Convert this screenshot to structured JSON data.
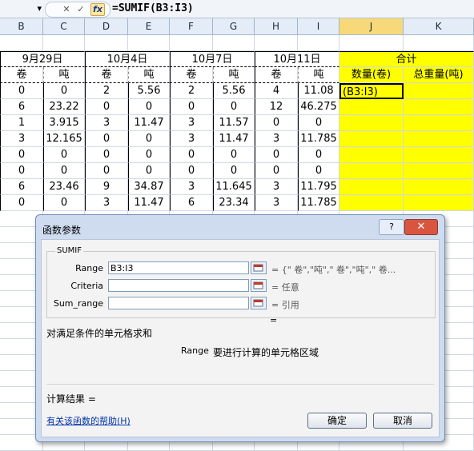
{
  "formula_bar": {
    "name_box_arrow": "▾",
    "cancel_icon": "✕",
    "enter_icon": "✓",
    "fx_label": "fx",
    "formula": "=SUMIF(B3:I3)"
  },
  "columns": [
    "B",
    "C",
    "D",
    "E",
    "F",
    "G",
    "H",
    "I",
    "J",
    "K"
  ],
  "header": {
    "dates": [
      "9月29日",
      "10月4日",
      "10月7日",
      "10月11日"
    ],
    "total": "合计",
    "unit_juan": "卷",
    "unit_dun": "吨",
    "qty_label": "数量(卷)",
    "weight_label": "总重量(吨)"
  },
  "rows": [
    [
      "0",
      "0",
      "2",
      "5.56",
      "2",
      "5.56",
      "4",
      "11.08",
      "(B3:I3)",
      ""
    ],
    [
      "6",
      "23.22",
      "0",
      "0",
      "0",
      "0",
      "12",
      "46.275",
      "",
      ""
    ],
    [
      "1",
      "3.915",
      "3",
      "11.47",
      "3",
      "11.57",
      "0",
      "0",
      "",
      ""
    ],
    [
      "3",
      "12.165",
      "0",
      "0",
      "3",
      "11.47",
      "3",
      "11.785",
      "",
      ""
    ],
    [
      "0",
      "0",
      "0",
      "0",
      "0",
      "0",
      "0",
      "0",
      "",
      ""
    ],
    [
      "0",
      "0",
      "0",
      "0",
      "0",
      "0",
      "0",
      "0",
      "",
      ""
    ],
    [
      "6",
      "23.46",
      "9",
      "34.87",
      "3",
      "11.645",
      "3",
      "11.795",
      "",
      ""
    ],
    [
      "0",
      "0",
      "3",
      "11.47",
      "6",
      "23.34",
      "3",
      "11.785",
      "",
      ""
    ]
  ],
  "dialog": {
    "title": "函数参数",
    "help_btn": "?",
    "close_btn": "✕",
    "function_name": "SUMIF",
    "args": [
      {
        "label": "Range",
        "value": "B3:I3",
        "result": "= {\" 卷\",\"吨\",\" 卷\",\"吨\",\" 卷..."
      },
      {
        "label": "Criteria",
        "value": "",
        "result": "= 任意"
      },
      {
        "label": "Sum_range",
        "value": "",
        "result": "= 引用"
      }
    ],
    "equals_line": "=",
    "description": "对满足条件的单元格求和",
    "arg_desc_name": "Range",
    "arg_desc_text": "要进行计算的单元格区域",
    "result_label": "计算结果 =",
    "help_link": "有关该函数的帮助(H)",
    "ok_label": "确定",
    "cancel_label": "取消",
    "colors": {
      "arrow": "#e8422f",
      "yellow": "#ffff00"
    }
  }
}
